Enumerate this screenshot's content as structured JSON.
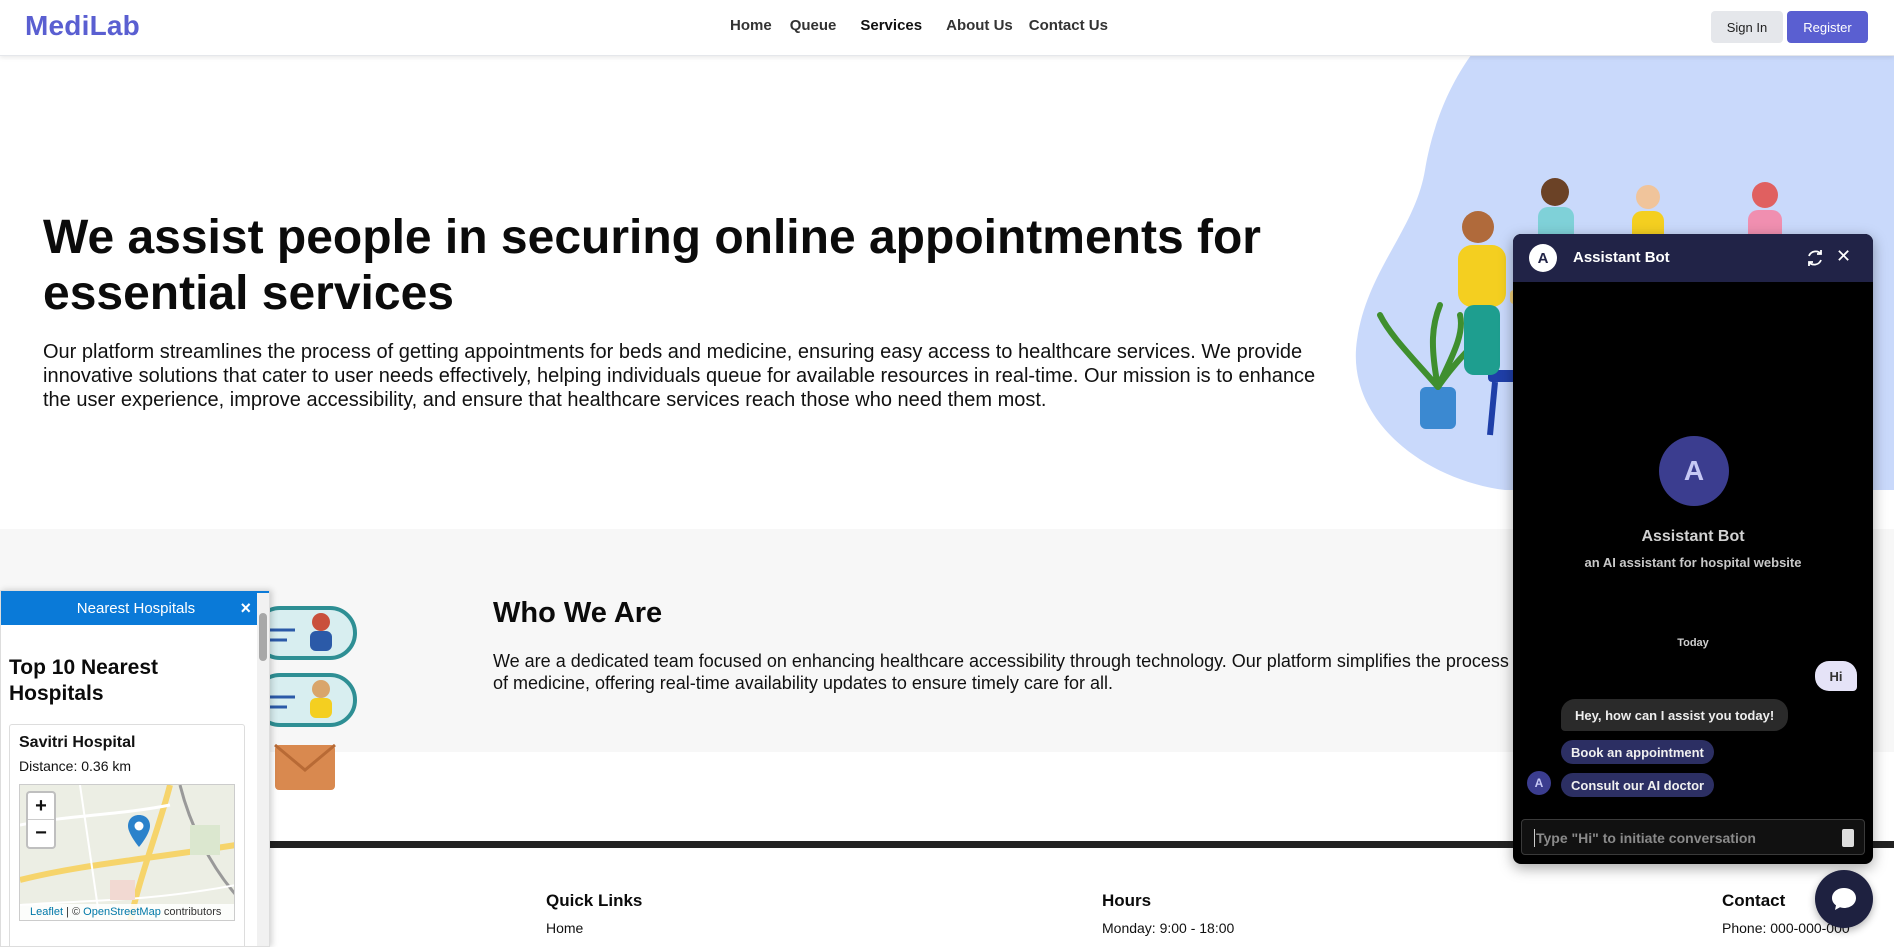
{
  "navbar": {
    "logo": "MediLab",
    "links": [
      "Home",
      "Queue",
      "Services",
      "About Us",
      "Contact Us"
    ],
    "signin_label": "Sign In",
    "register_label": "Register"
  },
  "hero": {
    "title": "We assist people in securing online appointments for essential services",
    "text": "Our platform streamlines the process of getting appointments for beds and medicine, ensuring easy access to healthcare services. We provide innovative solutions that cater to user needs effectively, helping individuals queue for available resources in real-time. Our mission is to enhance the user experience, improve accessibility, and ensure that healthcare services reach those who need them most."
  },
  "who": {
    "title": "Who We Are",
    "text": "We are a dedicated team focused on enhancing healthcare accessibility through technology. Our platform simplifies the process of medicine, offering real-time availability updates to ensure timely care for all."
  },
  "footer": {
    "quick_links_title": "Quick Links",
    "quick_links": [
      "Home"
    ],
    "hours_title": "Hours",
    "hours": [
      "Monday: 9:00 - 18:00"
    ],
    "contact_title": "Contact",
    "contact": [
      "Phone: 000-000-000"
    ]
  },
  "hospitals": {
    "header": "Nearest Hospitals",
    "close": "×",
    "heading": "Top 10 Nearest Hospitals",
    "items": [
      {
        "name": "Savitri Hospital",
        "distance": "Distance: 0.36 km"
      }
    ],
    "map": {
      "zoom_in": "+",
      "zoom_out": "−",
      "attribution_leaflet": "Leaflet",
      "attribution_sep": " | © ",
      "attribution_osm": "OpenStreetMap",
      "attribution_tail": " contributors"
    }
  },
  "chatbot": {
    "avatar_letter": "A",
    "title": "Assistant Bot",
    "bot_name": "Assistant Bot",
    "bot_desc": "an AI assistant for hospital website",
    "day": "Today",
    "user_message": "Hi",
    "bot_message": "Hey, how can I assist you today!",
    "quick_replies": [
      "Book an appointment",
      "Consult our AI doctor"
    ],
    "input_placeholder": "Type \"Hi\" to initiate conversation"
  },
  "colors": {
    "brand": "#5a5fd1",
    "chat_header": "#212347",
    "hospital_header": "#0a7ad8",
    "blob": "#c9d9fb"
  }
}
